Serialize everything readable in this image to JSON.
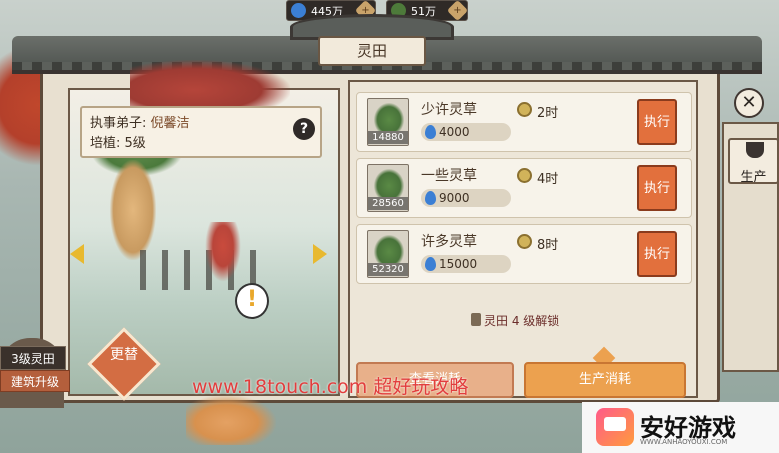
{
  "resources": [
    {
      "icon": "water-drop-icon",
      "value": "445万"
    },
    {
      "icon": "herb-icon",
      "value": "51万"
    }
  ],
  "title": "灵田",
  "info": {
    "disciple_label": "执事弟子:",
    "disciple_name": "倪馨洁",
    "cultivation_label": "培植:",
    "cultivation_level": "5级"
  },
  "left_bottom": {
    "level_tag": "3级灵田",
    "upgrade_button": "建筑升级",
    "change_button": "更替"
  },
  "herbs": [
    {
      "name": "少许灵草",
      "stock": "14880",
      "cost": "4000",
      "time": "2时",
      "action": "执行"
    },
    {
      "name": "一些灵草",
      "stock": "28560",
      "cost": "9000",
      "time": "4时",
      "action": "执行"
    },
    {
      "name": "许多灵草",
      "stock": "52320",
      "cost": "15000",
      "time": "8时",
      "action": "执行"
    }
  ],
  "unlock_hint": "灵田 4 级解锁",
  "bottom_buttons": {
    "view": "查看消耗",
    "produce": "生产消耗"
  },
  "side": {
    "close_symbol": "✕",
    "produce_tab": "生产"
  },
  "watermark": {
    "text": "www.18touch.com 超好玩攻略",
    "logo_text": "安好游戏",
    "logo_sub": "WWW.ANHAOYOUXI.COM"
  },
  "colors": {
    "accent_orange": "#e2703d",
    "water_blue": "#3b7fd4",
    "frame_brown": "#6b5846"
  }
}
